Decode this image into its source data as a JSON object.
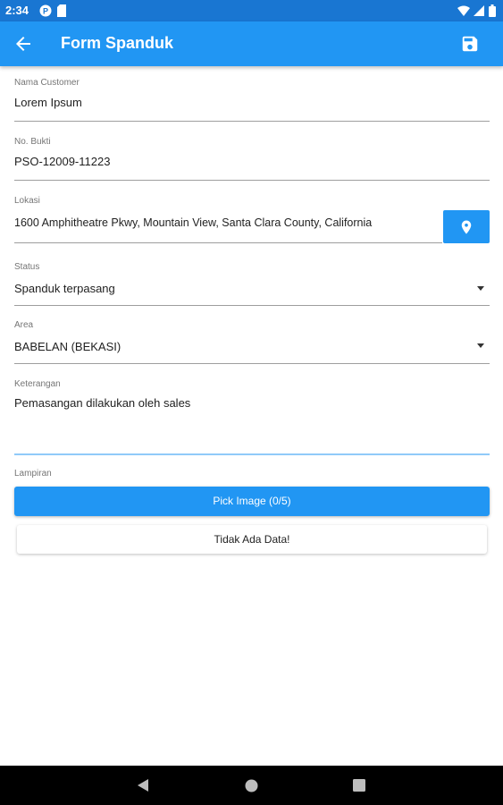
{
  "status_bar": {
    "time": "2:34",
    "icons": [
      "p-icon",
      "sim-icon",
      "wifi-icon",
      "signal-icon",
      "battery-icon"
    ]
  },
  "app_bar": {
    "title": "Form Spanduk",
    "back_icon": "arrow-back-icon",
    "save_icon": "save-icon",
    "background_color": "#2196f3"
  },
  "form": {
    "nama_customer": {
      "label": "Nama Customer",
      "value": "Lorem Ipsum"
    },
    "no_bukti": {
      "label": "No. Bukti",
      "value": "PSO-12009-11223"
    },
    "lokasi": {
      "label": "Lokasi",
      "value": "1600 Amphitheatre Pkwy, Mountain View, Santa Clara County, California",
      "button_icon": "location-pin-icon"
    },
    "status": {
      "label": "Status",
      "value": "Spanduk terpasang"
    },
    "area": {
      "label": "Area",
      "value": "BABELAN (BEKASI)"
    },
    "keterangan": {
      "label": "Keterangan",
      "value": "Pemasangan dilakukan oleh sales"
    }
  },
  "lampiran": {
    "label": "Lampiran",
    "pick_button": "Pick Image (0/5)",
    "empty_text": "Tidak Ada Data!"
  },
  "nav_bar": {
    "icons": [
      "back-triangle-icon",
      "home-circle-icon",
      "recents-square-icon"
    ]
  }
}
